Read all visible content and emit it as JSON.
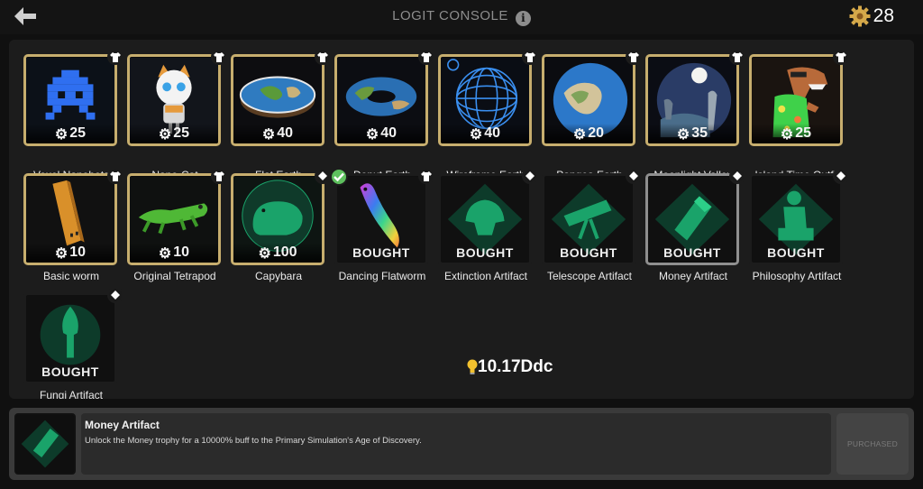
{
  "header": {
    "title": "LOGIT CONSOLE",
    "currency": "28"
  },
  "items": [
    {
      "name": "Voxel Nanobots",
      "price": "25"
    },
    {
      "name": "Nano-Cat",
      "price": "25"
    },
    {
      "name": "Flat Earth",
      "price": "40"
    },
    {
      "name": "Donut Earth",
      "price": "40"
    },
    {
      "name": "Wireframe Earth",
      "price": "40"
    },
    {
      "name": "Pangea Earth",
      "price": "20"
    },
    {
      "name": "Moonlight Valley",
      "price": "35"
    },
    {
      "name": "Island Time Outfit",
      "price": "25"
    },
    {
      "name": "Basic worm",
      "price": "10"
    },
    {
      "name": "Original Tetrapod",
      "price": "10"
    },
    {
      "name": "Capybara",
      "price": "100"
    },
    {
      "name": "Dancing Flatworm",
      "status": "BOUGHT"
    },
    {
      "name": "Extinction Artifact",
      "status": "BOUGHT"
    },
    {
      "name": "Telescope Artifact",
      "status": "BOUGHT"
    },
    {
      "name": "Money Artifact",
      "status": "BOUGHT"
    },
    {
      "name": "Philosophy Artifact",
      "status": "BOUGHT"
    },
    {
      "name": "Fungi Artifact",
      "status": "BOUGHT"
    }
  ],
  "energy": "10.17Ddc",
  "detail": {
    "name": "Money Artifact",
    "description": "Unlock the Money trophy for a 10000% buff to the Primary Simulation's Age of Discovery.",
    "button": "PURCHASED"
  },
  "colors": {
    "gold_border": "#c7ae6e",
    "artifact_green": "#1aa36a",
    "check_green": "#5ec05e"
  }
}
